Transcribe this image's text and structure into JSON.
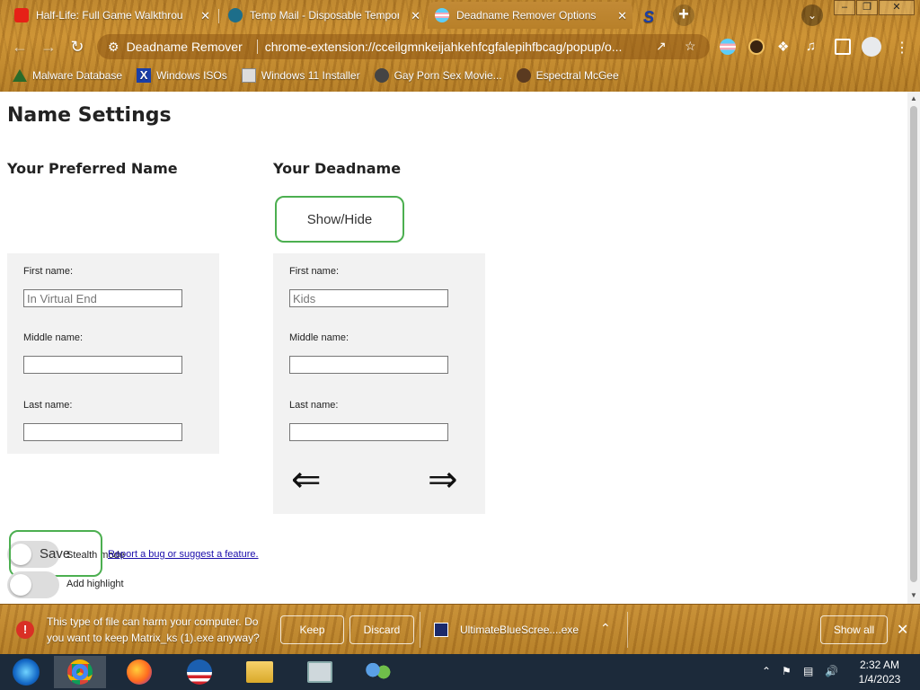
{
  "browser": {
    "tabs": [
      {
        "title": "Half-Life: Full Game Walkthrou",
        "close": "✕"
      },
      {
        "title": "Temp Mail - Disposable Tempora",
        "close": "✕"
      },
      {
        "title": "Deadname Remover Options",
        "close": "✕"
      },
      {
        "title": ""
      }
    ],
    "omnibox": {
      "extension_name": "Deadname Remover",
      "url": "chrome-extension://cceilgmnkeijahkehfcgfalepihfbcag/popup/o..."
    },
    "bookmarks": [
      {
        "label": "Malware Database"
      },
      {
        "label": "Windows ISOs"
      },
      {
        "label": "Windows 11 Installer"
      },
      {
        "label": "Gay Porn Sex Movie..."
      },
      {
        "label": "Espectral McGee"
      }
    ]
  },
  "page": {
    "title": "Name Settings",
    "preferred": {
      "heading": "Your Preferred Name",
      "first_label": "First name:",
      "first_value": "In Virtual End",
      "middle_label": "Middle name:",
      "middle_value": "",
      "last_label": "Last name:",
      "last_value": ""
    },
    "deadname": {
      "heading": "Your Deadname",
      "show_hide": "Show/Hide",
      "first_label": "First name:",
      "first_value": "Kids",
      "middle_label": "Middle name:",
      "middle_value": "",
      "last_label": "Last name:",
      "last_value": "",
      "prev_arrow": "⇐",
      "next_arrow": "⇒"
    },
    "save_label": "Save",
    "stealth_label": "Stealth mode",
    "highlight_label": "Add highlight",
    "bug_link": "Report a bug or suggest a feature."
  },
  "download_bar": {
    "message": "This type of file can harm your computer. Do you want to keep Matrix_ks (1).exe anyway?",
    "keep": "Keep",
    "discard": "Discard",
    "file_name": "UltimateBlueScree....exe",
    "show_all": "Show all"
  },
  "taskbar": {
    "time": "2:32 AM",
    "date": "1/4/2023"
  },
  "colors": {
    "accent_green": "#4caf50",
    "warning_red": "#d93025"
  }
}
